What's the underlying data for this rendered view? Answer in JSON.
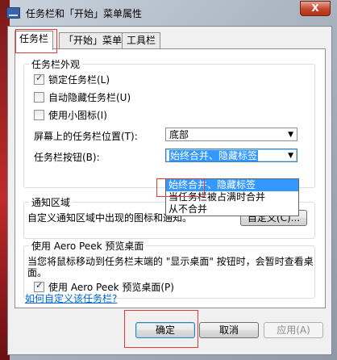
{
  "window": {
    "title": "任务栏和「开始」菜单属性",
    "close_label": "X"
  },
  "tabs": [
    {
      "label": "任务栏"
    },
    {
      "label": "「开始」菜单"
    },
    {
      "label": "工具栏"
    }
  ],
  "appearance": {
    "group_title": "任务栏外观",
    "lock_label": "锁定任务栏(L)",
    "lock_checked": true,
    "autohide_label": "自动隐藏任务栏(U)",
    "autohide_checked": false,
    "small_icons_label": "使用小图标(I)",
    "small_icons_checked": false,
    "position_label": "屏幕上的任务栏位置(T):",
    "position_value": "底部",
    "buttons_label": "任务栏按钮(B):",
    "buttons_value": "始终合并、隐藏标签",
    "buttons_options": [
      "始终合并、隐藏标签",
      "当任务栏被占满时合并",
      "从不合并"
    ]
  },
  "notification": {
    "group_title": "通知区域",
    "desc": "自定义通知区域中出现的图标和通知。",
    "customize_label": "自定义(C)..."
  },
  "aero_peek": {
    "group_title": "使用 Aero Peek 预览桌面",
    "desc": "当您将鼠标移动到任务栏末端的 \"显示桌面\" 按钮时，会暂时查看桌面。",
    "checkbox_label": "使用 Aero Peek 预览桌面(P)",
    "checked": true
  },
  "help_link": "如何自定义该任务栏?",
  "footer": {
    "ok_label": "确定",
    "cancel_label": "取消",
    "apply_label": "应用(A)"
  },
  "colors": {
    "dialog_bg": "#f0f0f0",
    "selection": "#3399ff",
    "link": "#0066cc",
    "highlight_box": "#e13a3a"
  }
}
